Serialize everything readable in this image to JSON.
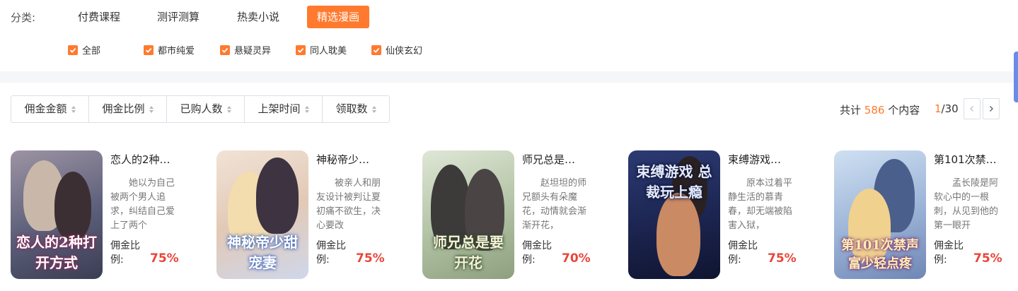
{
  "category": {
    "label": "分类:",
    "tabs": [
      {
        "label": "付费课程",
        "active": false
      },
      {
        "label": "测评测算",
        "active": false
      },
      {
        "label": "热卖小说",
        "active": false
      },
      {
        "label": "精选漫画",
        "active": true
      }
    ]
  },
  "filters": [
    {
      "label": "全部",
      "checked": true
    },
    {
      "label": "都市纯爱",
      "checked": true
    },
    {
      "label": "悬疑灵异",
      "checked": true
    },
    {
      "label": "同人耽美",
      "checked": true
    },
    {
      "label": "仙侠玄幻",
      "checked": true
    }
  ],
  "sort": [
    {
      "label": "佣金金额"
    },
    {
      "label": "佣金比例"
    },
    {
      "label": "已购人数"
    },
    {
      "label": "上架时间"
    },
    {
      "label": "领取数"
    }
  ],
  "totals": {
    "prefix": "共计",
    "count": "586",
    "suffix": "个内容"
  },
  "pager": {
    "current": "1",
    "total": "/30"
  },
  "commission_label": "佣金比例:",
  "cards": [
    {
      "title": "恋人的2种…",
      "desc": "她以为自己被两个男人追求，纠结自己爱上了两个",
      "rate": "75%",
      "cover_text": "恋人的2种打开方式",
      "cover_bg": "#6c6f86"
    },
    {
      "title": "神秘帝少…",
      "desc": "被亲人和朋友设计被判让夏初痛不欲生，决心要改",
      "rate": "75%",
      "cover_text": "神秘帝少甜宠妻",
      "cover_bg": "#e9d6c8"
    },
    {
      "title": "师兄总是…",
      "desc": "赵坦坦的师兄额头有朵魔花，动情就会渐渐开花，",
      "rate": "70%",
      "cover_text": "师兄总是要开花",
      "cover_bg": "#b9c9b0"
    },
    {
      "title": "束缚游戏…",
      "desc": "原本过着平静生活的慕青春，却无端被陷害入狱，",
      "rate": "75%",
      "cover_text": "束缚游戏 总裁玩上瘾",
      "cover_bg": "#1e2a55"
    },
    {
      "title": "第101次禁…",
      "desc": "孟长陵是阿软心中的一根刺，从见到他的第一眼开",
      "rate": "75%",
      "cover_text": "第101次禁声 富少轻点疼",
      "cover_bg": "#9fb7d9"
    }
  ]
}
